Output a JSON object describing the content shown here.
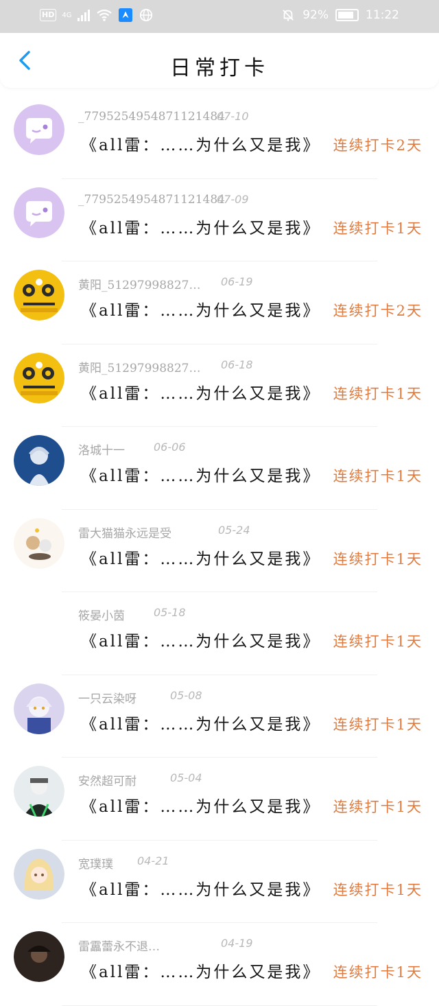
{
  "status_bar": {
    "hd": "HD",
    "network": "4G",
    "battery_text": "92%",
    "battery_level": 0.92,
    "time": "11:22"
  },
  "header": {
    "title": "日常打卡",
    "back_icon": "chevron-left-icon"
  },
  "colors": {
    "accent_blue": "#1e9bf0",
    "streak_orange": "#e07b3f",
    "meta_gray": "#a6a6a6"
  },
  "entries": [
    {
      "name": "_7795254954871121484",
      "date": "07-10",
      "content": "《all雷：……为什么又是我》",
      "streak": "连续打卡2天",
      "avatar": "chat-bubble-avatar"
    },
    {
      "name": "_7795254954871121484",
      "date": "07-09",
      "content": "《all雷：……为什么又是我》",
      "streak": "连续打卡1天",
      "avatar": "chat-bubble-avatar"
    },
    {
      "name": "黄阳_51297998827…",
      "date": "06-19",
      "content": "《all雷：……为什么又是我》",
      "streak": "连续打卡2天",
      "avatar": "tiger-avatar"
    },
    {
      "name": "黄阳_51297998827…",
      "date": "06-18",
      "content": "《all雷：……为什么又是我》",
      "streak": "连续打卡1天",
      "avatar": "tiger-avatar"
    },
    {
      "name": "洛城十一",
      "date": "06-06",
      "content": "《all雷：……为什么又是我》",
      "streak": "连续打卡1天",
      "avatar": "blue-anime-avatar"
    },
    {
      "name": "雷大猫猫永远是受",
      "date": "05-24",
      "content": "《all雷：……为什么又是我》",
      "streak": "连续打卡1天",
      "avatar": "cat-sketch-avatar"
    },
    {
      "name": "筱晏小茵",
      "date": "05-18",
      "content": "《all雷：……为什么又是我》",
      "streak": "连续打卡1天",
      "avatar": "blank-avatar"
    },
    {
      "name": "一只云染呀",
      "date": "05-08",
      "content": "《all雷：……为什么又是我》",
      "streak": "连续打卡1天",
      "avatar": "white-hair-anime-avatar"
    },
    {
      "name": "安然超可耐",
      "date": "05-04",
      "content": "《all雷：……为什么又是我》",
      "streak": "连续打卡1天",
      "avatar": "green-hoodie-anime-avatar"
    },
    {
      "name": "宽璞璞",
      "date": "04-21",
      "content": "《all雷：……为什么又是我》",
      "streak": "连续打卡1天",
      "avatar": "blonde-anime-avatar"
    },
    {
      "name": "雷靁蕾永不退…",
      "date": "04-19",
      "content": "《all雷：……为什么又是我》",
      "streak": "连续打卡1天",
      "avatar": "dark-anime-avatar"
    }
  ]
}
